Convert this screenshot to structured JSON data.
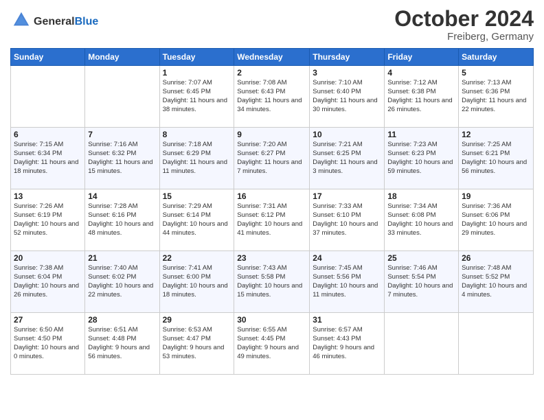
{
  "header": {
    "logo_line1": "General",
    "logo_line2": "Blue",
    "month": "October 2024",
    "location": "Freiberg, Germany"
  },
  "weekdays": [
    "Sunday",
    "Monday",
    "Tuesday",
    "Wednesday",
    "Thursday",
    "Friday",
    "Saturday"
  ],
  "weeks": [
    [
      {
        "day": "",
        "info": ""
      },
      {
        "day": "",
        "info": ""
      },
      {
        "day": "1",
        "info": "Sunrise: 7:07 AM\nSunset: 6:45 PM\nDaylight: 11 hours and 38 minutes."
      },
      {
        "day": "2",
        "info": "Sunrise: 7:08 AM\nSunset: 6:43 PM\nDaylight: 11 hours and 34 minutes."
      },
      {
        "day": "3",
        "info": "Sunrise: 7:10 AM\nSunset: 6:40 PM\nDaylight: 11 hours and 30 minutes."
      },
      {
        "day": "4",
        "info": "Sunrise: 7:12 AM\nSunset: 6:38 PM\nDaylight: 11 hours and 26 minutes."
      },
      {
        "day": "5",
        "info": "Sunrise: 7:13 AM\nSunset: 6:36 PM\nDaylight: 11 hours and 22 minutes."
      }
    ],
    [
      {
        "day": "6",
        "info": "Sunrise: 7:15 AM\nSunset: 6:34 PM\nDaylight: 11 hours and 18 minutes."
      },
      {
        "day": "7",
        "info": "Sunrise: 7:16 AM\nSunset: 6:32 PM\nDaylight: 11 hours and 15 minutes."
      },
      {
        "day": "8",
        "info": "Sunrise: 7:18 AM\nSunset: 6:29 PM\nDaylight: 11 hours and 11 minutes."
      },
      {
        "day": "9",
        "info": "Sunrise: 7:20 AM\nSunset: 6:27 PM\nDaylight: 11 hours and 7 minutes."
      },
      {
        "day": "10",
        "info": "Sunrise: 7:21 AM\nSunset: 6:25 PM\nDaylight: 11 hours and 3 minutes."
      },
      {
        "day": "11",
        "info": "Sunrise: 7:23 AM\nSunset: 6:23 PM\nDaylight: 10 hours and 59 minutes."
      },
      {
        "day": "12",
        "info": "Sunrise: 7:25 AM\nSunset: 6:21 PM\nDaylight: 10 hours and 56 minutes."
      }
    ],
    [
      {
        "day": "13",
        "info": "Sunrise: 7:26 AM\nSunset: 6:19 PM\nDaylight: 10 hours and 52 minutes."
      },
      {
        "day": "14",
        "info": "Sunrise: 7:28 AM\nSunset: 6:16 PM\nDaylight: 10 hours and 48 minutes."
      },
      {
        "day": "15",
        "info": "Sunrise: 7:29 AM\nSunset: 6:14 PM\nDaylight: 10 hours and 44 minutes."
      },
      {
        "day": "16",
        "info": "Sunrise: 7:31 AM\nSunset: 6:12 PM\nDaylight: 10 hours and 41 minutes."
      },
      {
        "day": "17",
        "info": "Sunrise: 7:33 AM\nSunset: 6:10 PM\nDaylight: 10 hours and 37 minutes."
      },
      {
        "day": "18",
        "info": "Sunrise: 7:34 AM\nSunset: 6:08 PM\nDaylight: 10 hours and 33 minutes."
      },
      {
        "day": "19",
        "info": "Sunrise: 7:36 AM\nSunset: 6:06 PM\nDaylight: 10 hours and 29 minutes."
      }
    ],
    [
      {
        "day": "20",
        "info": "Sunrise: 7:38 AM\nSunset: 6:04 PM\nDaylight: 10 hours and 26 minutes."
      },
      {
        "day": "21",
        "info": "Sunrise: 7:40 AM\nSunset: 6:02 PM\nDaylight: 10 hours and 22 minutes."
      },
      {
        "day": "22",
        "info": "Sunrise: 7:41 AM\nSunset: 6:00 PM\nDaylight: 10 hours and 18 minutes."
      },
      {
        "day": "23",
        "info": "Sunrise: 7:43 AM\nSunset: 5:58 PM\nDaylight: 10 hours and 15 minutes."
      },
      {
        "day": "24",
        "info": "Sunrise: 7:45 AM\nSunset: 5:56 PM\nDaylight: 10 hours and 11 minutes."
      },
      {
        "day": "25",
        "info": "Sunrise: 7:46 AM\nSunset: 5:54 PM\nDaylight: 10 hours and 7 minutes."
      },
      {
        "day": "26",
        "info": "Sunrise: 7:48 AM\nSunset: 5:52 PM\nDaylight: 10 hours and 4 minutes."
      }
    ],
    [
      {
        "day": "27",
        "info": "Sunrise: 6:50 AM\nSunset: 4:50 PM\nDaylight: 10 hours and 0 minutes."
      },
      {
        "day": "28",
        "info": "Sunrise: 6:51 AM\nSunset: 4:48 PM\nDaylight: 9 hours and 56 minutes."
      },
      {
        "day": "29",
        "info": "Sunrise: 6:53 AM\nSunset: 4:47 PM\nDaylight: 9 hours and 53 minutes."
      },
      {
        "day": "30",
        "info": "Sunrise: 6:55 AM\nSunset: 4:45 PM\nDaylight: 9 hours and 49 minutes."
      },
      {
        "day": "31",
        "info": "Sunrise: 6:57 AM\nSunset: 4:43 PM\nDaylight: 9 hours and 46 minutes."
      },
      {
        "day": "",
        "info": ""
      },
      {
        "day": "",
        "info": ""
      }
    ]
  ]
}
